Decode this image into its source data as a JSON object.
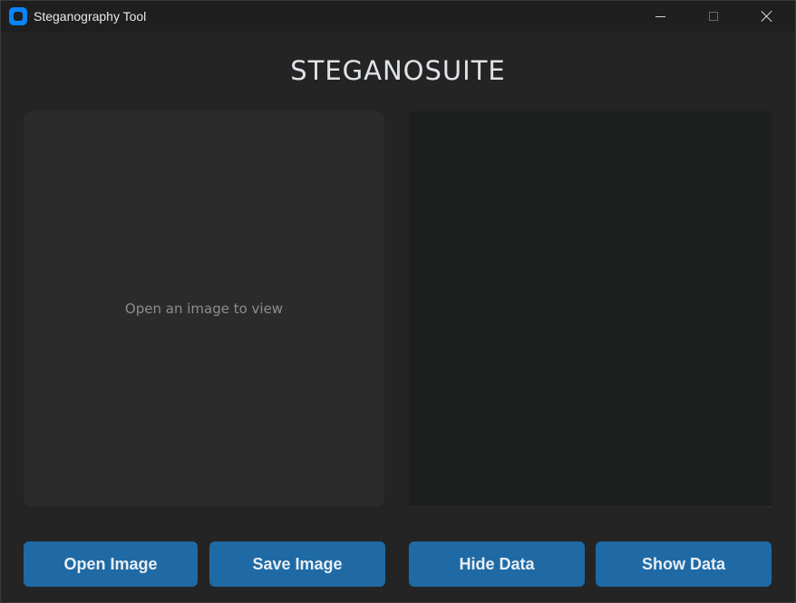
{
  "window": {
    "title": "Steganography Tool",
    "icon": "app-icon",
    "controls": [
      "minimize-icon",
      "maximize-icon",
      "close-icon"
    ]
  },
  "app": {
    "heading": "STEGANOSUITE"
  },
  "image_panel": {
    "placeholder": "Open an image to view"
  },
  "buttons": {
    "open_image": "Open Image",
    "save_image": "Save Image",
    "hide_data": "Hide Data",
    "show_data": "Show Data"
  },
  "colors": {
    "accent": "#1f6aa5",
    "window_bg": "#242424",
    "panel_bg": "#2b2b2b",
    "data_panel_bg": "#1d1e1e"
  }
}
